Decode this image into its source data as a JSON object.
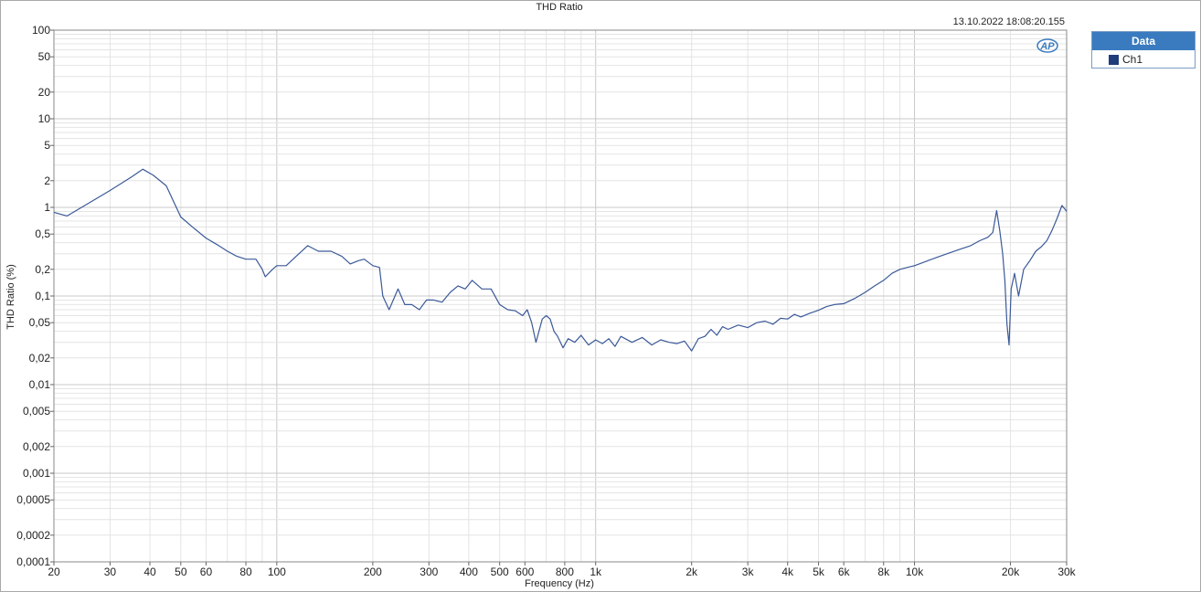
{
  "timestamp": "13.10.2022 18:08:20.155",
  "logo_text": "AP",
  "legend": {
    "header": "Data",
    "entries": [
      {
        "name": "Ch1",
        "color": "#1f3d7a"
      }
    ]
  },
  "chart_data": {
    "type": "line",
    "title": "THD Ratio",
    "xlabel": "Frequency (Hz)",
    "ylabel": "THD Ratio (%)",
    "xscale": "log",
    "yscale": "log",
    "xlim": [
      20,
      30000
    ],
    "ylim": [
      0.0001,
      100
    ],
    "grid": true,
    "legend_position": "right",
    "x_ticks": [
      {
        "v": 20,
        "label": "20"
      },
      {
        "v": 30,
        "label": "30"
      },
      {
        "v": 40,
        "label": "40"
      },
      {
        "v": 50,
        "label": "50"
      },
      {
        "v": 60,
        "label": "60"
      },
      {
        "v": 80,
        "label": "80"
      },
      {
        "v": 100,
        "label": "100"
      },
      {
        "v": 200,
        "label": "200"
      },
      {
        "v": 300,
        "label": "300"
      },
      {
        "v": 400,
        "label": "400"
      },
      {
        "v": 500,
        "label": "500"
      },
      {
        "v": 600,
        "label": "600"
      },
      {
        "v": 800,
        "label": "800"
      },
      {
        "v": 1000,
        "label": "1k"
      },
      {
        "v": 2000,
        "label": "2k"
      },
      {
        "v": 3000,
        "label": "3k"
      },
      {
        "v": 4000,
        "label": "4k"
      },
      {
        "v": 5000,
        "label": "5k"
      },
      {
        "v": 6000,
        "label": "6k"
      },
      {
        "v": 8000,
        "label": "8k"
      },
      {
        "v": 10000,
        "label": "10k"
      },
      {
        "v": 20000,
        "label": "20k"
      },
      {
        "v": 30000,
        "label": "30k"
      }
    ],
    "y_ticks": [
      {
        "v": 100,
        "label": "100"
      },
      {
        "v": 50,
        "label": "50"
      },
      {
        "v": 20,
        "label": "20"
      },
      {
        "v": 10,
        "label": "10"
      },
      {
        "v": 5,
        "label": "5"
      },
      {
        "v": 2,
        "label": "2"
      },
      {
        "v": 1,
        "label": "1"
      },
      {
        "v": 0.5,
        "label": "0,5"
      },
      {
        "v": 0.2,
        "label": "0,2"
      },
      {
        "v": 0.1,
        "label": "0,1"
      },
      {
        "v": 0.05,
        "label": "0,05"
      },
      {
        "v": 0.02,
        "label": "0,02"
      },
      {
        "v": 0.01,
        "label": "0,01"
      },
      {
        "v": 0.005,
        "label": "0,005"
      },
      {
        "v": 0.002,
        "label": "0,002"
      },
      {
        "v": 0.001,
        "label": "0,001"
      },
      {
        "v": 0.0005,
        "label": "0,0005"
      },
      {
        "v": 0.0002,
        "label": "0,0002"
      },
      {
        "v": 0.0001,
        "label": "0,0001"
      }
    ],
    "series": [
      {
        "name": "Ch1",
        "color": "#3b5998",
        "points": [
          [
            20,
            0.88
          ],
          [
            22,
            0.8
          ],
          [
            25,
            1.05
          ],
          [
            30,
            1.55
          ],
          [
            35,
            2.2
          ],
          [
            38,
            2.7
          ],
          [
            41,
            2.3
          ],
          [
            45,
            1.75
          ],
          [
            50,
            0.78
          ],
          [
            55,
            0.58
          ],
          [
            60,
            0.45
          ],
          [
            65,
            0.38
          ],
          [
            70,
            0.32
          ],
          [
            75,
            0.28
          ],
          [
            80,
            0.26
          ],
          [
            86,
            0.26
          ],
          [
            90,
            0.2
          ],
          [
            92,
            0.165
          ],
          [
            97,
            0.2
          ],
          [
            100,
            0.22
          ],
          [
            107,
            0.22
          ],
          [
            115,
            0.28
          ],
          [
            125,
            0.37
          ],
          [
            135,
            0.32
          ],
          [
            148,
            0.32
          ],
          [
            160,
            0.28
          ],
          [
            170,
            0.23
          ],
          [
            180,
            0.25
          ],
          [
            188,
            0.26
          ],
          [
            200,
            0.22
          ],
          [
            210,
            0.21
          ],
          [
            215,
            0.1
          ],
          [
            225,
            0.07
          ],
          [
            240,
            0.12
          ],
          [
            252,
            0.08
          ],
          [
            265,
            0.08
          ],
          [
            280,
            0.07
          ],
          [
            295,
            0.09
          ],
          [
            310,
            0.09
          ],
          [
            330,
            0.085
          ],
          [
            350,
            0.11
          ],
          [
            370,
            0.13
          ],
          [
            390,
            0.12
          ],
          [
            410,
            0.15
          ],
          [
            440,
            0.12
          ],
          [
            470,
            0.12
          ],
          [
            500,
            0.08
          ],
          [
            530,
            0.07
          ],
          [
            560,
            0.068
          ],
          [
            590,
            0.06
          ],
          [
            610,
            0.07
          ],
          [
            630,
            0.05
          ],
          [
            650,
            0.03
          ],
          [
            680,
            0.055
          ],
          [
            700,
            0.06
          ],
          [
            720,
            0.055
          ],
          [
            740,
            0.04
          ],
          [
            760,
            0.035
          ],
          [
            790,
            0.026
          ],
          [
            820,
            0.033
          ],
          [
            860,
            0.03
          ],
          [
            900,
            0.036
          ],
          [
            950,
            0.028
          ],
          [
            1000,
            0.032
          ],
          [
            1050,
            0.029
          ],
          [
            1100,
            0.033
          ],
          [
            1150,
            0.027
          ],
          [
            1200,
            0.035
          ],
          [
            1300,
            0.03
          ],
          [
            1400,
            0.034
          ],
          [
            1500,
            0.028
          ],
          [
            1600,
            0.032
          ],
          [
            1700,
            0.03
          ],
          [
            1800,
            0.029
          ],
          [
            1900,
            0.031
          ],
          [
            2000,
            0.024
          ],
          [
            2100,
            0.033
          ],
          [
            2200,
            0.035
          ],
          [
            2300,
            0.042
          ],
          [
            2400,
            0.036
          ],
          [
            2500,
            0.045
          ],
          [
            2600,
            0.042
          ],
          [
            2800,
            0.047
          ],
          [
            3000,
            0.044
          ],
          [
            3200,
            0.05
          ],
          [
            3400,
            0.052
          ],
          [
            3600,
            0.048
          ],
          [
            3800,
            0.056
          ],
          [
            4000,
            0.055
          ],
          [
            4200,
            0.062
          ],
          [
            4400,
            0.058
          ],
          [
            4700,
            0.064
          ],
          [
            5000,
            0.069
          ],
          [
            5300,
            0.076
          ],
          [
            5600,
            0.08
          ],
          [
            6000,
            0.082
          ],
          [
            6500,
            0.094
          ],
          [
            7000,
            0.11
          ],
          [
            7500,
            0.13
          ],
          [
            8000,
            0.15
          ],
          [
            8500,
            0.18
          ],
          [
            9000,
            0.2
          ],
          [
            9500,
            0.21
          ],
          [
            10000,
            0.22
          ],
          [
            11000,
            0.25
          ],
          [
            12000,
            0.28
          ],
          [
            13000,
            0.31
          ],
          [
            14000,
            0.34
          ],
          [
            15000,
            0.37
          ],
          [
            16000,
            0.42
          ],
          [
            17000,
            0.46
          ],
          [
            17600,
            0.52
          ],
          [
            18100,
            0.92
          ],
          [
            18500,
            0.55
          ],
          [
            18900,
            0.3
          ],
          [
            19200,
            0.15
          ],
          [
            19500,
            0.048
          ],
          [
            19800,
            0.028
          ],
          [
            20100,
            0.12
          ],
          [
            20600,
            0.18
          ],
          [
            21200,
            0.1
          ],
          [
            22000,
            0.2
          ],
          [
            23000,
            0.25
          ],
          [
            24000,
            0.32
          ],
          [
            25000,
            0.36
          ],
          [
            26000,
            0.42
          ],
          [
            27000,
            0.55
          ],
          [
            28000,
            0.75
          ],
          [
            29000,
            1.05
          ],
          [
            30000,
            0.9
          ]
        ]
      }
    ]
  }
}
